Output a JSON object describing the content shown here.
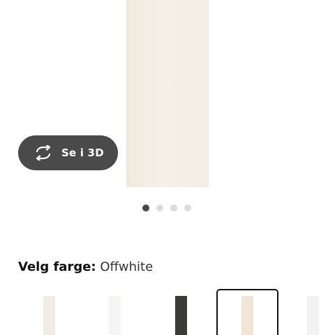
{
  "gallery": {
    "view_3d_label": "Se i 3D",
    "dots": [
      {
        "active": true
      },
      {
        "active": false
      },
      {
        "active": false
      },
      {
        "active": false
      }
    ]
  },
  "color_picker": {
    "label": "Velg farge:",
    "selected_value": "Offwhite",
    "swatches": [
      {
        "color": "#f1ede4",
        "selected": false
      },
      {
        "color": "#f5f5f4",
        "selected": false
      },
      {
        "color": "#3a3a38",
        "selected": false
      },
      {
        "color": "#efe6d6",
        "selected": true
      },
      {
        "color": "#f2f2f2",
        "selected": false
      }
    ]
  }
}
